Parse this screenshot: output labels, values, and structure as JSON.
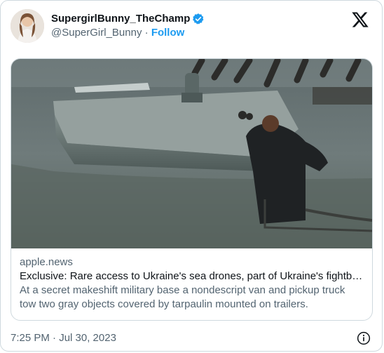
{
  "author": {
    "display_name": "SupergirlBunny_TheChamp",
    "handle": "@SuperGirl_Bunny",
    "separator": " · ",
    "follow_label": "Follow"
  },
  "link_card": {
    "domain": "apple.news",
    "title": "Exclusive: Rare access to Ukraine's sea drones, part of Ukraine's fightbac...",
    "description": "At a secret makeshift military base a nondescript van and pickup truck tow two gray objects covered by tarpaulin mounted on trailers."
  },
  "footer": {
    "timestamp": "7:25 PM · Jul 30, 2023"
  },
  "icons": {
    "verified": "verified-badge-icon",
    "platform": "x-logo-icon",
    "info": "info-icon"
  },
  "colors": {
    "accent": "#1d9bf0",
    "secondary_text": "#536471",
    "border": "#cfd9de"
  }
}
